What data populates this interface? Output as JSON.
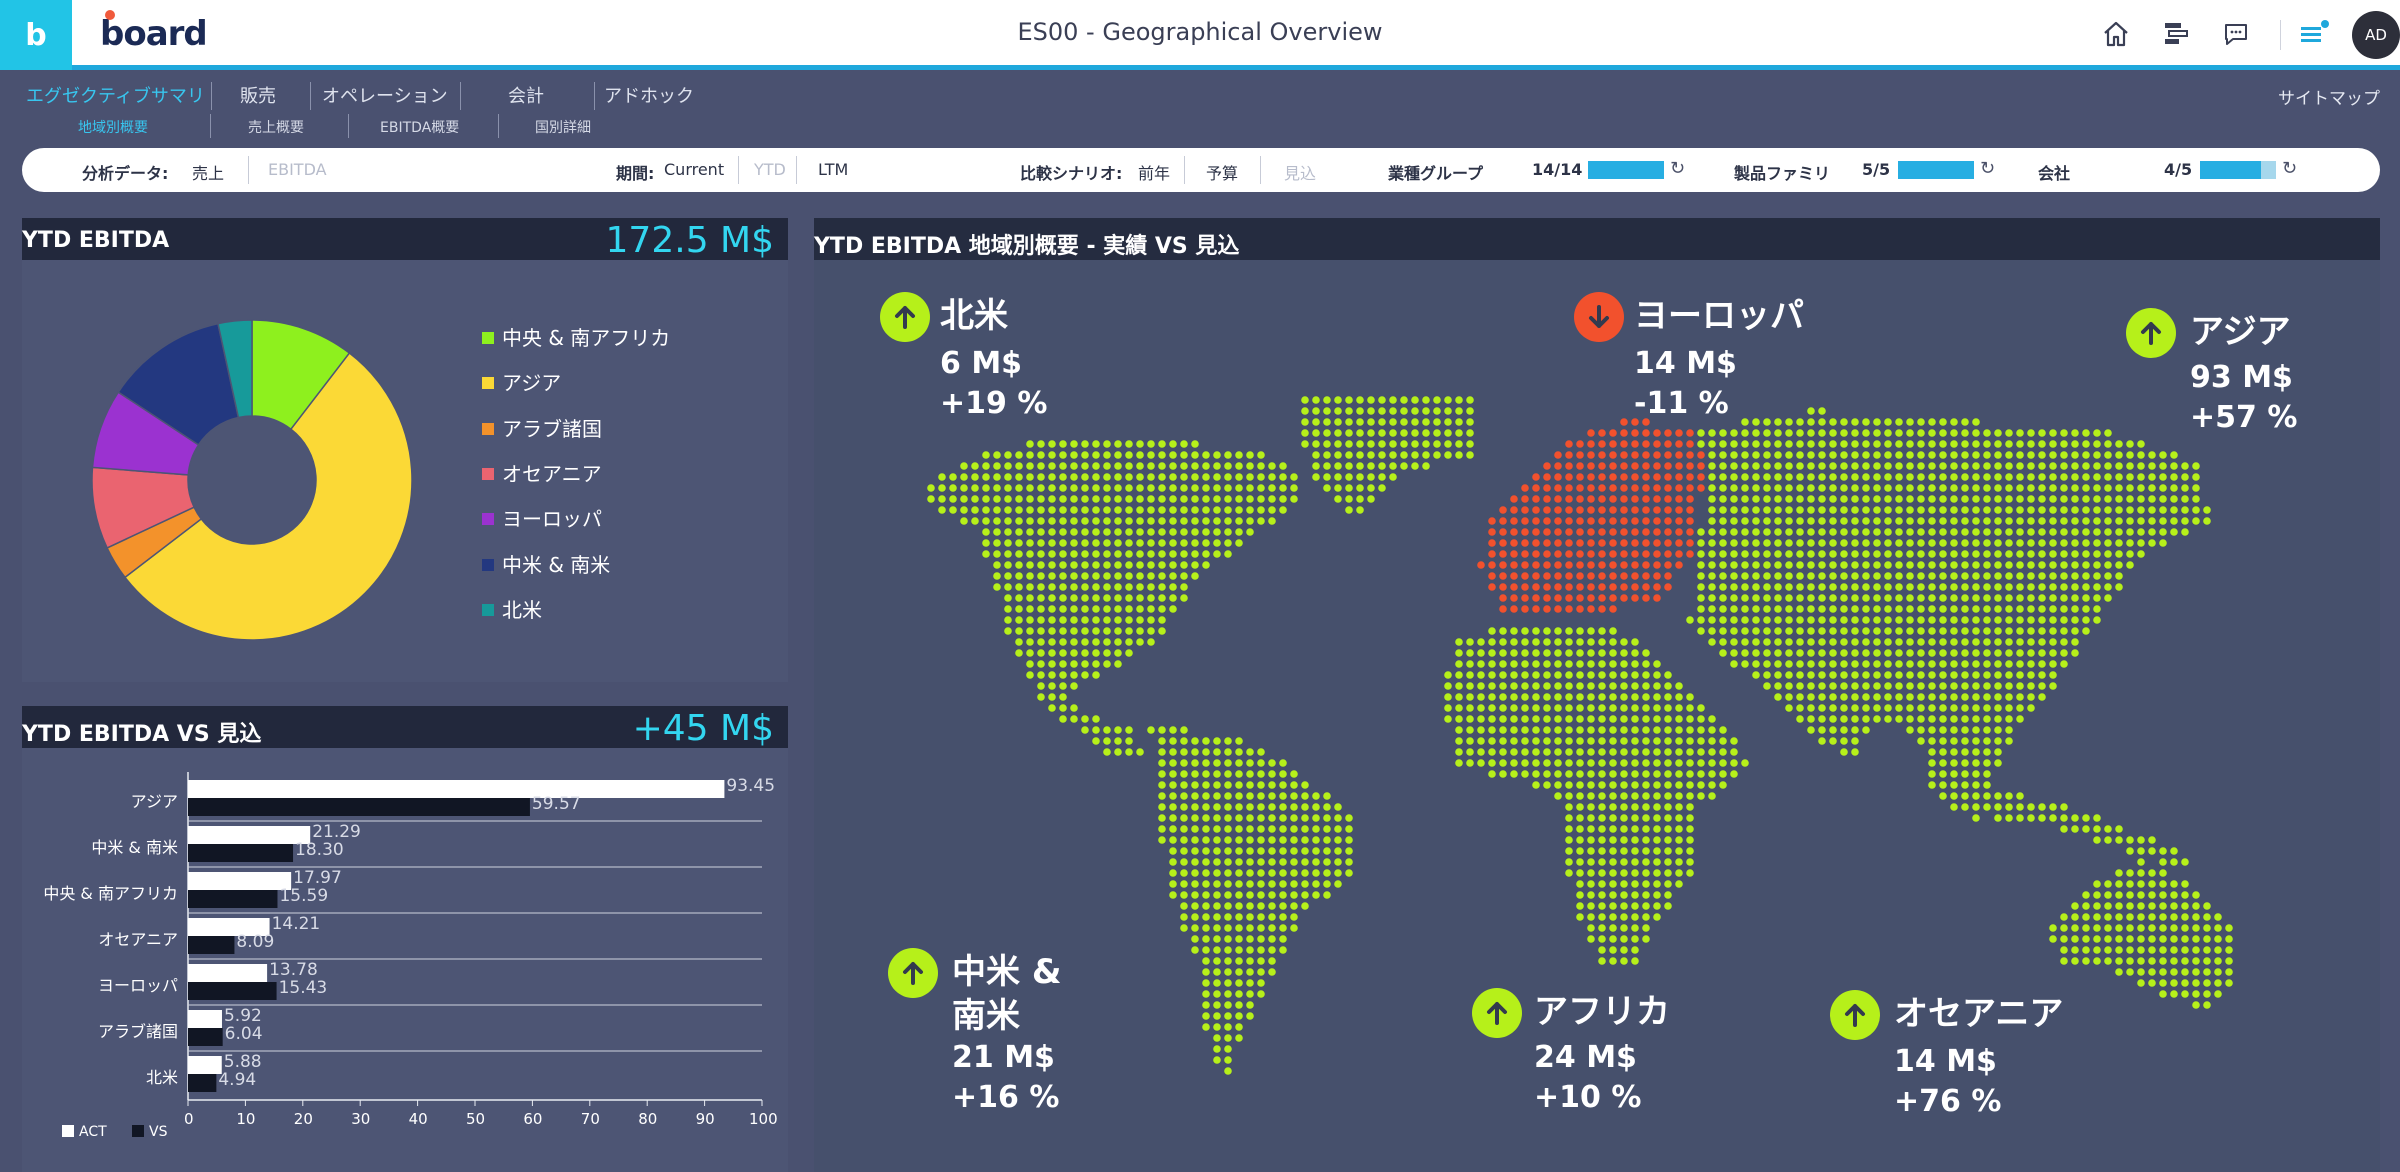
{
  "app": {
    "tile_letter": "b",
    "logo": "board",
    "title": "ES00 - Geographical Overview",
    "avatar": "AD"
  },
  "topbar_icons": [
    "home-icon",
    "hierarchy-icon",
    "chat-icon",
    "menu-icon"
  ],
  "nav": {
    "main": [
      "エグゼクティブサマリ",
      "販売",
      "オペレーション",
      "会計",
      "アドホック"
    ],
    "sub": [
      "地域別概要",
      "売上概要",
      "EBITDA概要",
      "国別詳細"
    ],
    "sitemap": "サイトマップ"
  },
  "filters": {
    "analysis_label": "分析データ:",
    "analysis_values": [
      "売上",
      "EBITDA"
    ],
    "period_label": "期間:",
    "period_values": [
      "Current",
      "YTD",
      "LTM"
    ],
    "scenario_label": "比較シナリオ:",
    "scenario_values": [
      "前年",
      "予算",
      "見込"
    ],
    "groups": [
      {
        "label": "業種グループ",
        "count": "14/14",
        "fill": 1.0
      },
      {
        "label": "製品ファミリ",
        "count": "5/5",
        "fill": 1.0
      },
      {
        "label": "会社",
        "count": "4/5",
        "fill": 0.8
      }
    ]
  },
  "donut_panel": {
    "title": "YTD EBITDA",
    "kpi": "172.5 M$",
    "chart_data": {
      "type": "pie",
      "labels": [
        "中央 & 南アフリカ",
        "アジア",
        "アラブ諸国",
        "オセアニア",
        "ヨーロッパ",
        "中米 & 南米",
        "北米"
      ],
      "values": [
        17.97,
        93.45,
        5.92,
        14.21,
        13.78,
        21.29,
        5.88
      ],
      "colors": [
        "#8ef01e",
        "#fbd936",
        "#f3922b",
        "#ea6470",
        "#9b32d0",
        "#233880",
        "#179a9a"
      ]
    }
  },
  "bar_panel": {
    "title": "YTD EBITDA VS 見込",
    "kpi": "+45 M$",
    "chart_data": {
      "type": "bar",
      "orientation": "horizontal",
      "categories": [
        "アジア",
        "中米 & 南米",
        "中央 & 南アフリカ",
        "オセアニア",
        "ヨーロッパ",
        "アラブ諸国",
        "北米"
      ],
      "series": [
        {
          "name": "ACT",
          "values": [
            93.45,
            21.29,
            17.97,
            14.21,
            13.78,
            5.92,
            5.88
          ],
          "color": "#ffffff"
        },
        {
          "name": "VS",
          "values": [
            59.57,
            18.3,
            15.59,
            8.09,
            15.43,
            6.04,
            4.94
          ],
          "color": "#111624"
        }
      ],
      "xlim": [
        0,
        100
      ],
      "xticks": [
        0,
        10,
        20,
        30,
        40,
        50,
        60,
        70,
        80,
        90,
        100
      ],
      "grid": false,
      "legend": "bottom-left"
    }
  },
  "map_panel": {
    "title": "YTD EBITDA 地域別概要 - 実績  VS 見込",
    "colors": {
      "up": "#b6f01a",
      "down": "#f2512d",
      "land": "#b6f01a"
    },
    "regions": [
      {
        "key": "na",
        "name": "北米",
        "value": "6 M$",
        "pct": "+19 %",
        "trend": "up"
      },
      {
        "key": "eu",
        "name": "ヨーロッパ",
        "value": "14 M$",
        "pct": "-11 %",
        "trend": "down"
      },
      {
        "key": "as",
        "name": "アジア",
        "value": "93 M$",
        "pct": "+57 %",
        "trend": "up"
      },
      {
        "key": "sa",
        "name": "中米 &\n南米",
        "value": "21 M$",
        "pct": "+16 %",
        "trend": "up"
      },
      {
        "key": "af",
        "name": "アフリカ",
        "value": "24 M$",
        "pct": "+10 %",
        "trend": "up"
      },
      {
        "key": "oc",
        "name": "オセアニア",
        "value": "14 M$",
        "pct": "+76 %",
        "trend": "up"
      }
    ]
  }
}
